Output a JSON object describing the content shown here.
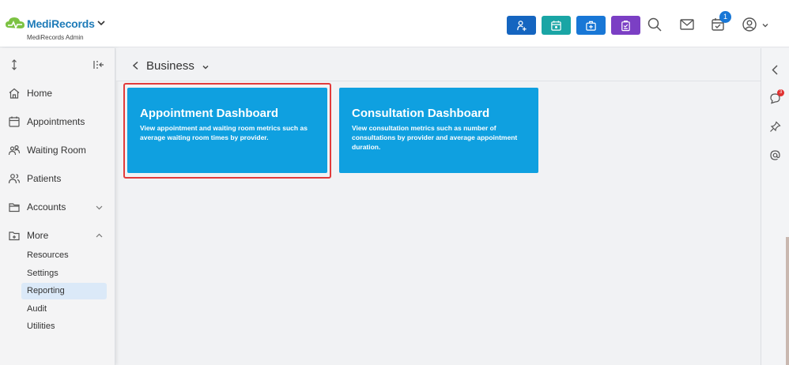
{
  "app": {
    "brand": "MediRecords",
    "subtitle": "MediRecords Admin"
  },
  "header": {
    "quick_actions": [
      {
        "name": "add-patient-icon",
        "color": "#1565c0"
      },
      {
        "name": "calendar-icon",
        "color": "#1aa5a5"
      },
      {
        "name": "medical-kit-icon",
        "color": "#1877d6"
      },
      {
        "name": "clipboard-icon",
        "color": "#7b3fc4"
      }
    ],
    "notification_count": "1"
  },
  "sidebar": {
    "items": [
      {
        "label": "Home",
        "icon": "home-icon"
      },
      {
        "label": "Appointments",
        "icon": "calendar-icon"
      },
      {
        "label": "Waiting Room",
        "icon": "people-icon"
      },
      {
        "label": "Patients",
        "icon": "user-group-icon"
      },
      {
        "label": "Accounts",
        "icon": "folder-icon"
      },
      {
        "label": "More",
        "icon": "folder-plus-icon"
      }
    ],
    "sub_items": [
      {
        "label": "Resources"
      },
      {
        "label": "Settings"
      },
      {
        "label": "Reporting",
        "active": true
      },
      {
        "label": "Audit"
      },
      {
        "label": "Utilities"
      }
    ]
  },
  "breadcrumb": {
    "title": "Business"
  },
  "tiles": [
    {
      "title": "Appointment Dashboard",
      "description": "View appointment and waiting room metrics such as average waiting room times by provider.",
      "selected": true
    },
    {
      "title": "Consultation Dashboard",
      "description": "View consultation metrics such as number of consultations by provider and average appointment duration.",
      "selected": false
    }
  ],
  "rail": {
    "chat_badge": "3"
  },
  "colors": {
    "tile": "#0fa0e0",
    "highlight": "#e23b3b",
    "active_nav": "#dbe9f8"
  }
}
